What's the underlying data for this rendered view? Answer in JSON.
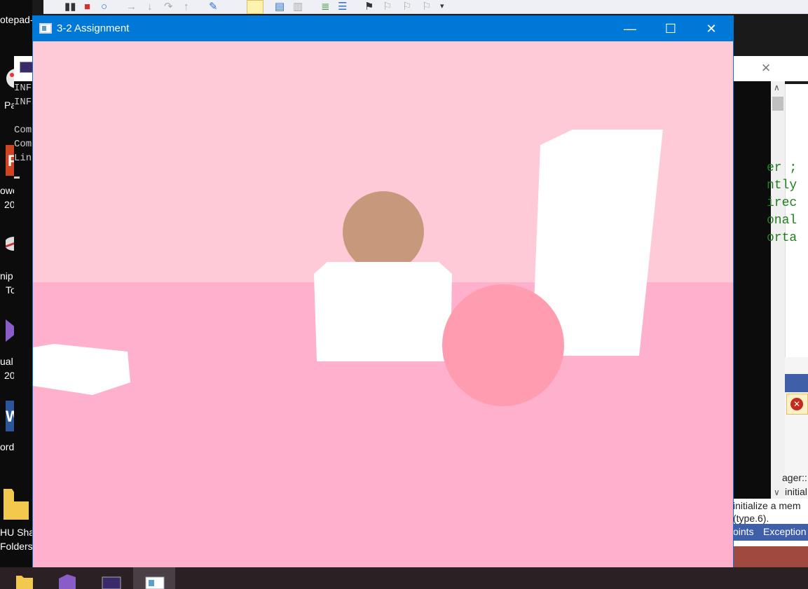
{
  "desktop": {
    "labels": [
      "otepad-",
      "Pa",
      "owe",
      "20",
      "nip",
      "To",
      "ual",
      "20",
      "ord",
      "HU Sha",
      "Folders"
    ]
  },
  "console": {
    "lines": [
      "INF",
      "INF",
      "Com",
      "Com",
      "Lin"
    ]
  },
  "code_snippets": [
    "er ;",
    "ntly",
    "irec",
    "onal",
    "orta"
  ],
  "vs_bottom": {
    "lines": [
      "ager::",
      "initial",
      "initialize a mem",
      "(type.6)."
    ],
    "tabs": [
      "oints",
      "Exception"
    ]
  },
  "window": {
    "title": "3-2 Assignment",
    "minimize_glyph": "—",
    "maximize_glyph": "☐",
    "close_glyph": "✕"
  },
  "colors": {
    "sky": "#ffcad8",
    "floor": "#ffb0cc",
    "white_objects": "#ffffff",
    "head": "#c8987c",
    "ball": "#ff9cb0",
    "titlebar": "#0078d7"
  }
}
